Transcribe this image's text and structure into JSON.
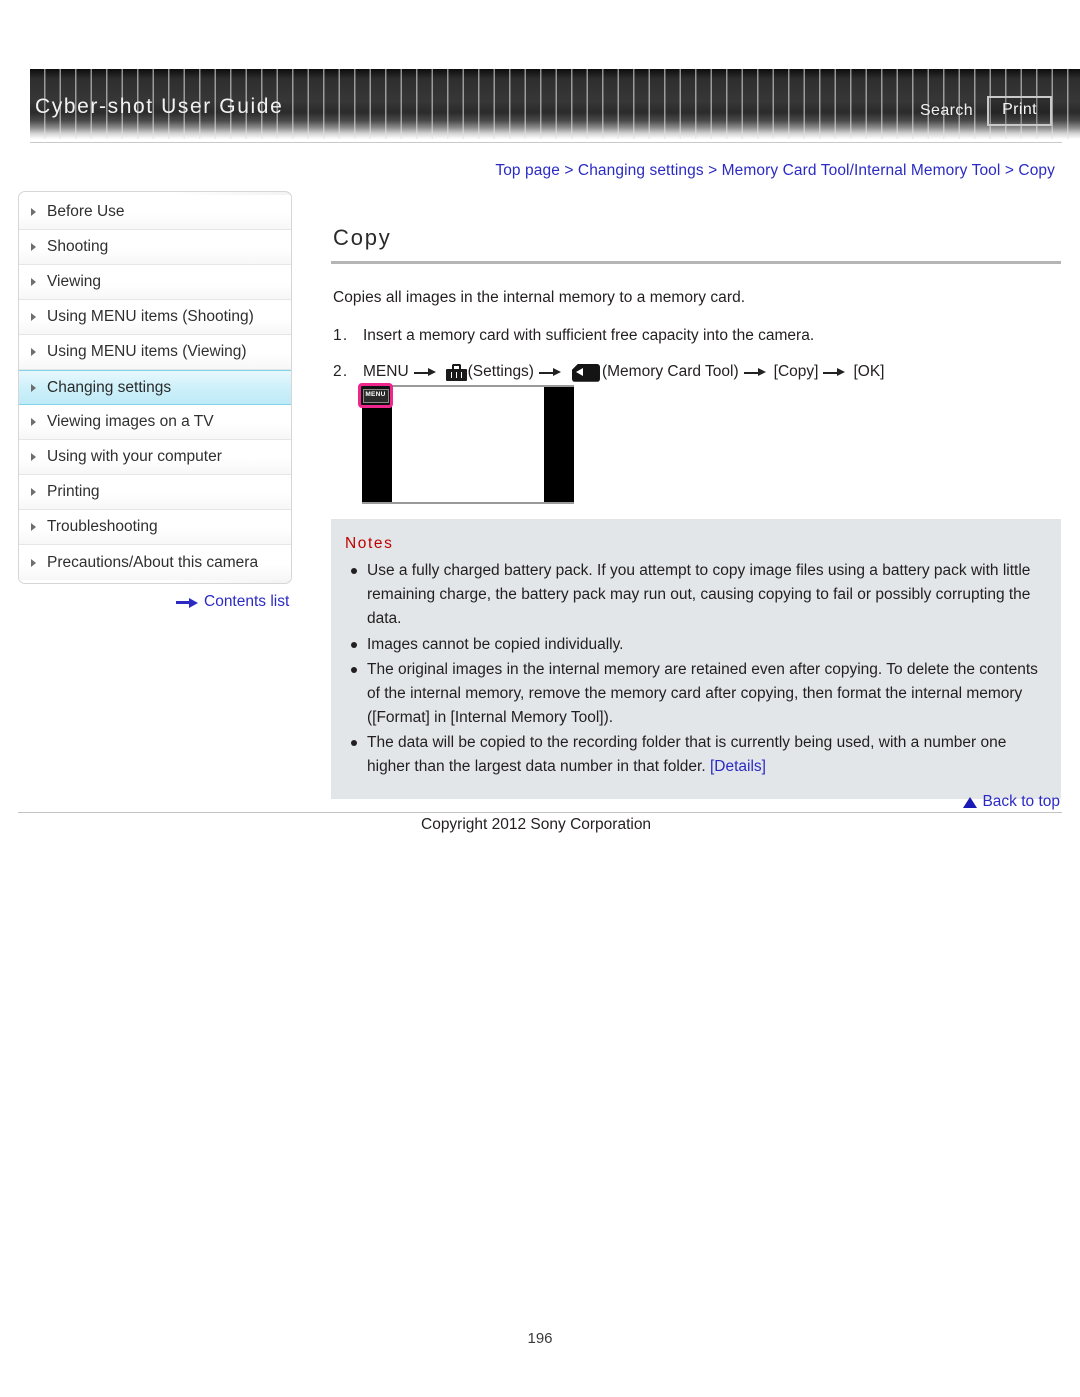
{
  "header": {
    "title": "Cyber-shot User Guide",
    "search_label": "Search",
    "print_label": "Print"
  },
  "breadcrumb": {
    "text": "Top page > Changing settings > Memory Card Tool/Internal Memory Tool > Copy"
  },
  "sidebar": {
    "items": [
      {
        "label": "Before Use",
        "selected": false
      },
      {
        "label": "Shooting",
        "selected": false
      },
      {
        "label": "Viewing",
        "selected": false
      },
      {
        "label": "Using MENU items (Shooting)",
        "selected": false
      },
      {
        "label": "Using MENU items (Viewing)",
        "selected": false
      },
      {
        "label": "Changing settings",
        "selected": true
      },
      {
        "label": "Viewing images on a TV",
        "selected": false
      },
      {
        "label": "Using with your computer",
        "selected": false
      },
      {
        "label": "Printing",
        "selected": false
      },
      {
        "label": "Troubleshooting",
        "selected": false
      },
      {
        "label": "Precautions/About this camera",
        "selected": false
      }
    ],
    "contents_list_label": "Contents list"
  },
  "main": {
    "title": "Copy",
    "intro": "Copies all images in the internal memory to a memory card.",
    "steps": [
      {
        "number": "1.",
        "text": "Insert a memory card with sufficient free capacity into the camera."
      },
      {
        "number": "2.",
        "prefix": "MENU",
        "settings_label": "(Settings)",
        "memcard_label": "(Memory Card Tool)",
        "copy_label": "[Copy]",
        "ok_label": "[OK]"
      }
    ],
    "figure": {
      "menu_button_label": "MENU"
    }
  },
  "notes": {
    "title": "Notes",
    "items": [
      "Use a fully charged battery pack. If you attempt to copy image files using a battery pack with little remaining charge, the battery pack may run out, causing copying to fail or possibly corrupting the data.",
      "Images cannot be copied individually.",
      "The original images in the internal memory are retained even after copying. To delete the contents of the internal memory, remove the memory card after copying, then format the internal memory ([Format] in [Internal Memory Tool]).",
      "The data will be copied to the recording folder that is currently being used, with a number one higher than the largest data number in that folder. "
    ],
    "details_link": "[Details]"
  },
  "footer": {
    "back_to_top_label": "Back to top",
    "copyright": "Copyright 2012 Sony Corporation",
    "page_number": "196"
  },
  "colors": {
    "link": "#2b2bc4",
    "notes_title": "#c00000",
    "highlight": "#f0268f",
    "selected_nav": "#ccf0fa",
    "notes_bg": "#e2e6e9"
  }
}
